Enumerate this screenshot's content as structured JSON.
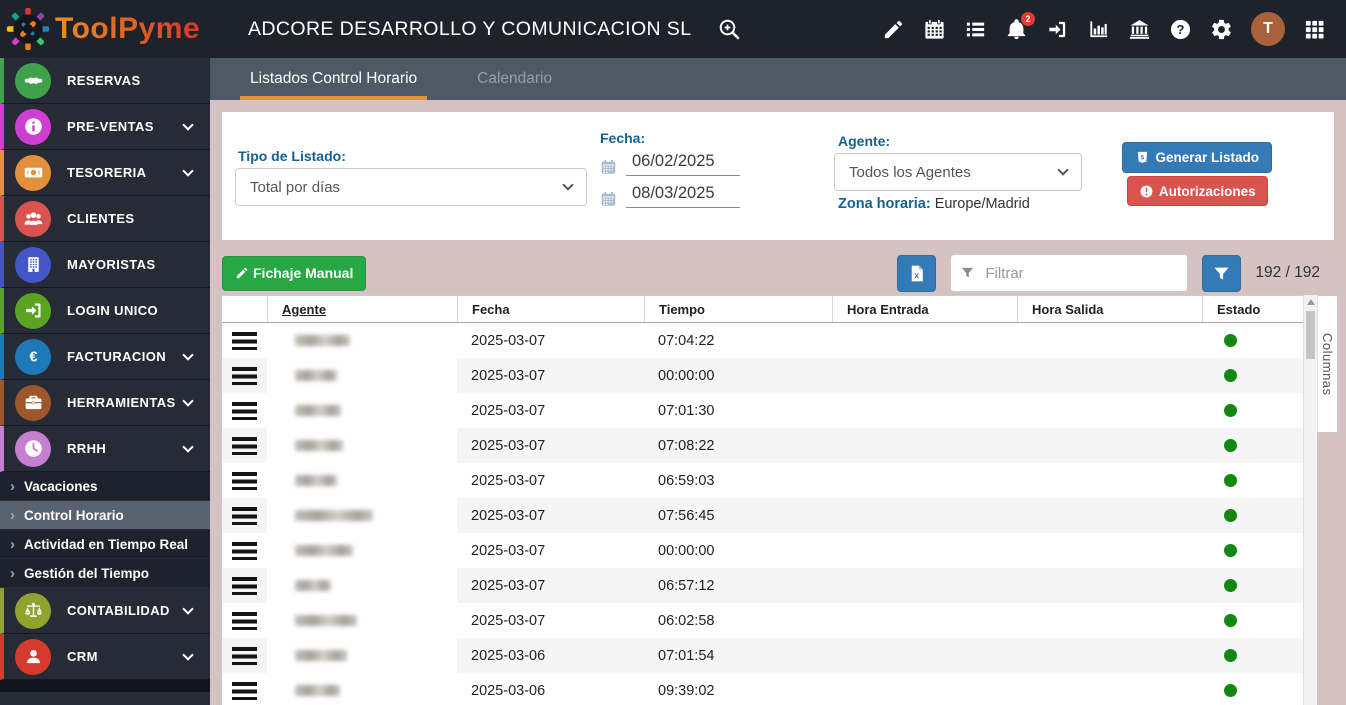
{
  "app": {
    "logo_text": "ToolPyme"
  },
  "header": {
    "company_name": "ADCORE DESARROLLO Y COMUNICACION SL",
    "notification_count": "2",
    "avatar_initial": "T"
  },
  "tabs": [
    {
      "label": "Listados Control Horario",
      "active": true
    },
    {
      "label": "Calendario",
      "active": false
    }
  ],
  "sidebar": {
    "items": [
      {
        "label": "RESERVAS",
        "icon": "handshake-icon",
        "color": "#3fa14c",
        "expandable": false
      },
      {
        "label": "PRE-VENTAS",
        "icon": "info-icon",
        "color": "#cf3ed1",
        "expandable": true
      },
      {
        "label": "TESORERIA",
        "icon": "money-icon",
        "color": "#e2903b",
        "expandable": true
      },
      {
        "label": "CLIENTES",
        "icon": "clients-icon",
        "color": "#d9534f",
        "expandable": false
      },
      {
        "label": "MAYORISTAS",
        "icon": "building-icon",
        "color": "#4456c7",
        "expandable": false
      },
      {
        "label": "LOGIN UNICO",
        "icon": "signin-icon",
        "color": "#5aa421",
        "expandable": false
      },
      {
        "label": "FACTURACION",
        "icon": "euro-icon",
        "color": "#1f78b8",
        "expandable": true
      },
      {
        "label": "HERRAMIENTAS",
        "icon": "briefcase-icon",
        "color": "#9e562b",
        "expandable": true
      },
      {
        "label": "RRHH",
        "icon": "clock-icon",
        "color": "#c47fd1",
        "expandable": true,
        "expanded": true,
        "children": [
          {
            "label": "Vacaciones",
            "active": false
          },
          {
            "label": "Control Horario",
            "active": true
          },
          {
            "label": "Actividad en Tiempo Real",
            "active": false
          },
          {
            "label": "Gestión del Tiempo",
            "active": false
          }
        ]
      },
      {
        "label": "CONTABILIDAD",
        "icon": "scales-icon",
        "color": "#8fa32e",
        "expandable": true
      },
      {
        "label": "CRM",
        "icon": "person-icon",
        "color": "#d63a2c",
        "expandable": true
      }
    ]
  },
  "filters": {
    "tipo_label": "Tipo de Listado:",
    "tipo_value": "Total por días",
    "fecha_label": "Fecha:",
    "fecha_desde": "06/02/2025",
    "fecha_hasta": "08/03/2025",
    "agente_label": "Agente:",
    "agente_value": "Todos los Agentes",
    "zona_label": "Zona horaria:",
    "zona_value": "Europe/Madrid",
    "generar_label": "Generar Listado",
    "autorizaciones_label": "Autorizaciones"
  },
  "toolbar": {
    "fichaje_label": "Fichaje Manual",
    "filter_placeholder": "Filtrar",
    "count": "192 / 192"
  },
  "table": {
    "columns": [
      "Agente",
      "Fecha",
      "Tiempo",
      "Hora Entrada",
      "Hora Salida",
      "Estado"
    ],
    "columnas_label": "Columnas",
    "rows": [
      {
        "fecha": "2025-03-07",
        "tiempo": "07:04:22",
        "hora_entrada": "",
        "hora_salida": "",
        "estado_color": "#128712"
      },
      {
        "fecha": "2025-03-07",
        "tiempo": "00:00:00",
        "hora_entrada": "",
        "hora_salida": "",
        "estado_color": "#128712"
      },
      {
        "fecha": "2025-03-07",
        "tiempo": "07:01:30",
        "hora_entrada": "",
        "hora_salida": "",
        "estado_color": "#128712"
      },
      {
        "fecha": "2025-03-07",
        "tiempo": "07:08:22",
        "hora_entrada": "",
        "hora_salida": "",
        "estado_color": "#128712"
      },
      {
        "fecha": "2025-03-07",
        "tiempo": "06:59:03",
        "hora_entrada": "",
        "hora_salida": "",
        "estado_color": "#128712"
      },
      {
        "fecha": "2025-03-07",
        "tiempo": "07:56:45",
        "hora_entrada": "",
        "hora_salida": "",
        "estado_color": "#128712"
      },
      {
        "fecha": "2025-03-07",
        "tiempo": "00:00:00",
        "hora_entrada": "",
        "hora_salida": "",
        "estado_color": "#128712"
      },
      {
        "fecha": "2025-03-07",
        "tiempo": "06:57:12",
        "hora_entrada": "",
        "hora_salida": "",
        "estado_color": "#128712"
      },
      {
        "fecha": "2025-03-07",
        "tiempo": "06:02:58",
        "hora_entrada": "",
        "hora_salida": "",
        "estado_color": "#128712"
      },
      {
        "fecha": "2025-03-06",
        "tiempo": "07:01:54",
        "hora_entrada": "",
        "hora_salida": "",
        "estado_color": "#128712"
      },
      {
        "fecha": "2025-03-06",
        "tiempo": "09:39:02",
        "hora_entrada": "",
        "hora_salida": "",
        "estado_color": "#128712"
      }
    ]
  },
  "colors": {
    "accent_orange": "#e0923f",
    "primary_blue": "#337ab7",
    "danger_red": "#d9534f",
    "success_green": "#28a745",
    "estado_green": "#128712",
    "header_bg": "#1e222b",
    "sidebar_bg": "#262b36",
    "tabbar_bg": "#4e5966",
    "content_bg": "#d5c3c3"
  }
}
